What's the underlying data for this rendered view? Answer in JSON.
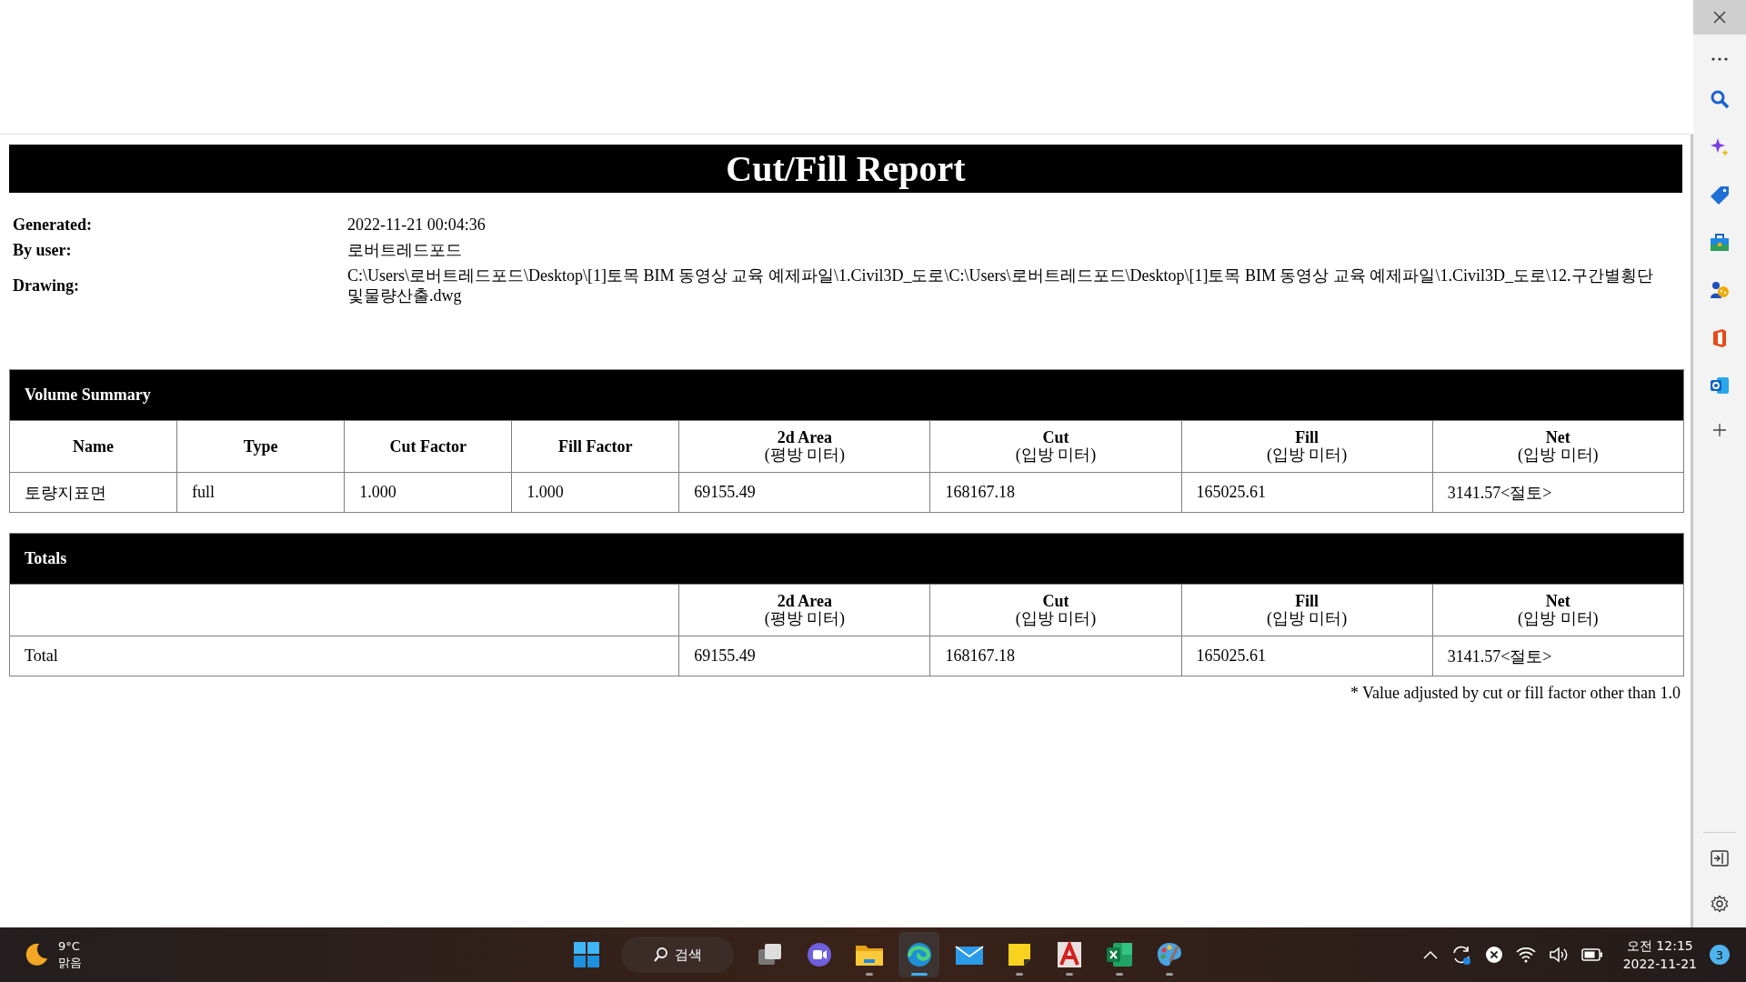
{
  "report": {
    "title": "Cut/Fill Report",
    "info": [
      {
        "label": "Generated:",
        "value": "2022-11-21 00:04:36"
      },
      {
        "label": "By user:",
        "value": "로버트레드포드"
      },
      {
        "label": "Drawing:",
        "value": "C:\\Users\\로버트레드포드\\Desktop\\[1]토목 BIM 동영상 교육 예제파일\\1.Civil3D_도로\\C:\\Users\\로버트레드포드\\Desktop\\[1]토목 BIM 동영상 교육 예제파일\\1.Civil3D_도로\\12.구간별횡단및물량산출.dwg"
      }
    ],
    "volume_summary": {
      "title": "Volume Summary",
      "columns": [
        {
          "name": "Name"
        },
        {
          "name": "Type"
        },
        {
          "name": "Cut Factor"
        },
        {
          "name": "Fill Factor"
        },
        {
          "name": "2d Area",
          "unit": "(평방 미터)"
        },
        {
          "name": "Cut",
          "unit": "(입방 미터)"
        },
        {
          "name": "Fill",
          "unit": "(입방 미터)"
        },
        {
          "name": "Net",
          "unit": "(입방 미터)"
        }
      ],
      "rows": [
        [
          "토량지표면",
          "full",
          "1.000",
          "1.000",
          "69155.49",
          "168167.18",
          "165025.61",
          "3141.57<절토>"
        ]
      ]
    },
    "totals": {
      "title": "Totals",
      "columns": [
        {
          "name": "2d Area",
          "unit": "(평방 미터)"
        },
        {
          "name": "Cut",
          "unit": "(입방 미터)"
        },
        {
          "name": "Fill",
          "unit": "(입방 미터)"
        },
        {
          "name": "Net",
          "unit": "(입방 미터)"
        }
      ],
      "rows": [
        {
          "label": "Total",
          "values": [
            "69155.49",
            "168167.18",
            "165025.61",
            "3141.57<절토>"
          ]
        }
      ]
    },
    "footnote": "* Value adjusted by cut or fill factor other than 1.0"
  },
  "sidebar": {
    "top": [
      {
        "kind": "search"
      },
      {
        "kind": "sparkle"
      },
      {
        "kind": "tag"
      },
      {
        "kind": "toolbox"
      },
      {
        "kind": "games"
      },
      {
        "kind": "office"
      },
      {
        "kind": "outlook"
      },
      {
        "kind": "plus"
      }
    ],
    "bottom": [
      {
        "kind": "panel"
      },
      {
        "kind": "settings"
      }
    ]
  },
  "taskbar": {
    "weather": {
      "temperature": "9°C",
      "condition": "맑음"
    },
    "search": {
      "label": "검색"
    },
    "apps": [
      {
        "kind": "start",
        "running": false,
        "selected": false
      },
      {
        "kind": "search"
      },
      {
        "kind": "taskview",
        "running": false,
        "selected": false
      },
      {
        "kind": "chat",
        "running": false,
        "selected": false
      },
      {
        "kind": "explorer",
        "running": true,
        "selected": false
      },
      {
        "kind": "edge",
        "running": true,
        "selected": true
      },
      {
        "kind": "mail",
        "running": false,
        "selected": false
      },
      {
        "kind": "sticky",
        "running": true,
        "selected": false
      },
      {
        "kind": "acrobat",
        "running": true,
        "selected": false
      },
      {
        "kind": "excel",
        "running": true,
        "selected": false
      },
      {
        "kind": "paint",
        "running": true,
        "selected": false
      }
    ],
    "tray": {
      "time": "오전 12:15",
      "date": "2022-11-21",
      "notifications": "3"
    }
  }
}
